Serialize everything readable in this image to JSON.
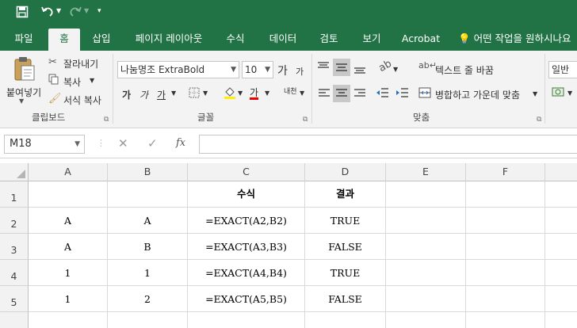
{
  "quick_access": {
    "save_icon": "save-icon",
    "undo_icon": "undo-icon",
    "redo_icon": "redo-icon",
    "customize_icon": "customize-icon"
  },
  "tabs": [
    {
      "label": "파일",
      "active": false
    },
    {
      "label": "홈",
      "active": true
    },
    {
      "label": "삽입",
      "active": false
    },
    {
      "label": "페이지 레이아웃",
      "active": false
    },
    {
      "label": "수식",
      "active": false
    },
    {
      "label": "데이터",
      "active": false
    },
    {
      "label": "검토",
      "active": false
    },
    {
      "label": "보기",
      "active": false
    },
    {
      "label": "Acrobat",
      "active": false
    }
  ],
  "tell_me": "어떤 작업을 원하시나요",
  "clipboard": {
    "paste_label": "붙여넣기",
    "cut_label": "잘라내기",
    "copy_label": "복사",
    "format_painter_label": "서식 복사",
    "group_label": "클립보드"
  },
  "font": {
    "font_name": "나눔명조 ExtraBold",
    "font_size": "10",
    "grow_label": "가",
    "shrink_label": "가",
    "bold_label": "가",
    "italic_label": "가",
    "underline_label": "가",
    "font_color_label": "가",
    "phonetic_label": "내천",
    "group_label": "글꼴"
  },
  "alignment": {
    "wrap_text_label": "텍스트 줄 바꿈",
    "merge_center_label": "병합하고 가운데 맞춤",
    "group_label": "맞춤"
  },
  "number": {
    "format": "일반"
  },
  "formula_bar": {
    "name_box": "M18",
    "fx_label": "fx",
    "formula": ""
  },
  "sheet": {
    "columns": [
      "A",
      "B",
      "C",
      "D",
      "E",
      "F"
    ],
    "rows": [
      {
        "num": "1",
        "cells": [
          "",
          "",
          "수식",
          "결과",
          "",
          ""
        ]
      },
      {
        "num": "2",
        "cells": [
          "A",
          "A",
          "=EXACT(A2,B2)",
          "TRUE",
          "",
          ""
        ]
      },
      {
        "num": "3",
        "cells": [
          "A",
          "B",
          "=EXACT(A3,B3)",
          "FALSE",
          "",
          ""
        ]
      },
      {
        "num": "4",
        "cells": [
          "1",
          "1",
          "=EXACT(A4,B4)",
          "TRUE",
          "",
          ""
        ]
      },
      {
        "num": "5",
        "cells": [
          "1",
          "2",
          "=EXACT(A5,B5)",
          "FALSE",
          "",
          ""
        ]
      },
      {
        "num": "",
        "cells": [
          "",
          "",
          "",
          "",
          "",
          ""
        ]
      }
    ]
  },
  "colors": {
    "accent": "#217346"
  }
}
